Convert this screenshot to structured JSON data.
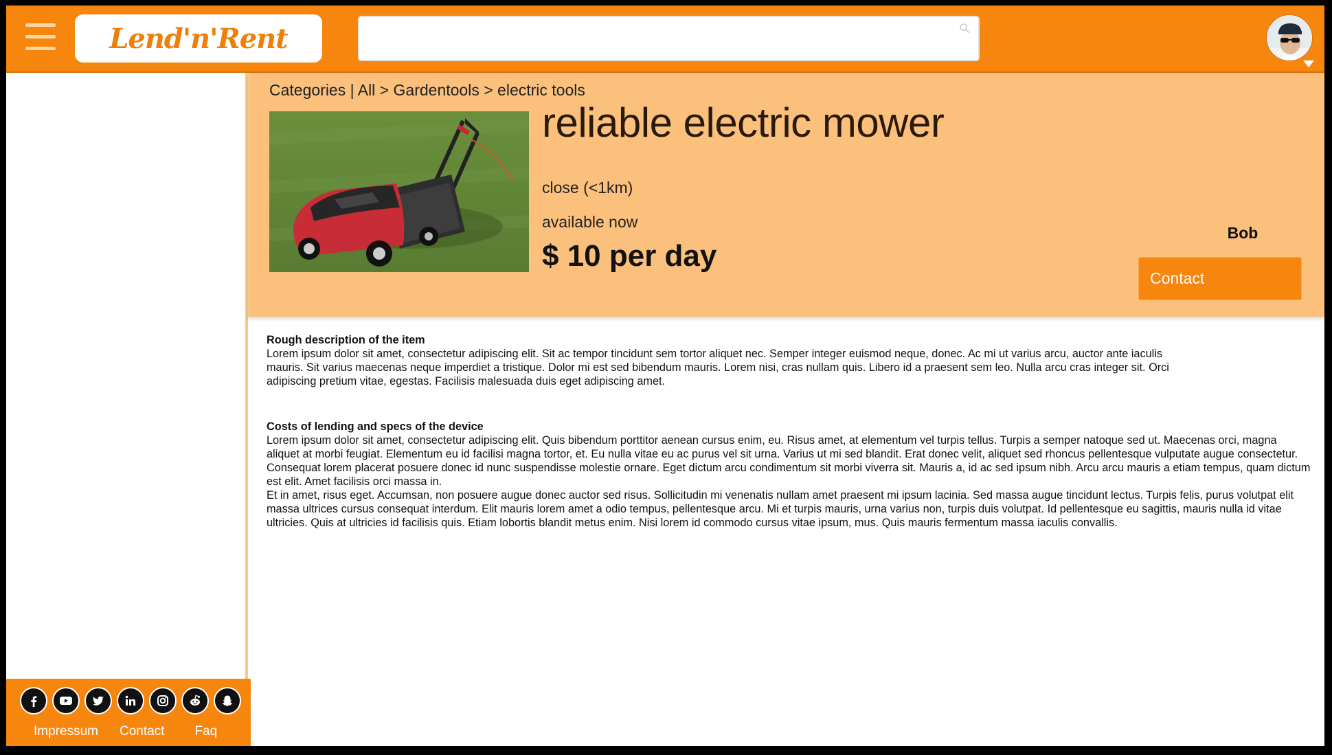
{
  "header": {
    "logo_text": "Lend'n'Rent",
    "search_placeholder": "",
    "menu_icon": "hamburger-menu-icon",
    "search_icon": "search-icon",
    "avatar_icon": "user-avatar",
    "caret_icon": "caret-down-icon"
  },
  "colors": {
    "brand": "#f7860f",
    "panel": "#fcc07d",
    "sidebar_border": "#f6c68a"
  },
  "item": {
    "breadcrumb": {
      "root": "Categories",
      "separator": " | ",
      "all": "All",
      "arrow1": " > ",
      "category": "Gardentools",
      "arrow2": " > ",
      "subcategory": "electric tools"
    },
    "title": "reliable electric mower",
    "distance": "close (<1km)",
    "availability": "available now",
    "price": "$ 10 per day",
    "owner": "Bob",
    "contact_label": "Contact"
  },
  "description": {
    "heading1": "Rough description of the item",
    "text1": "Lorem ipsum dolor sit amet, consectetur adipiscing elit. Sit ac tempor tincidunt sem tortor aliquet nec. Semper integer euismod neque, donec. Ac mi ut varius arcu, auctor ante iaculis mauris. Sit varius maecenas neque imperdiet a tristique. Dolor mi est sed bibendum mauris. Lorem nisi, cras nullam quis. Libero id a praesent sem leo. Nulla arcu cras integer sit. Orci adipiscing pretium vitae, egestas. Facilisis malesuada duis eget adipiscing amet.",
    "heading2": "Costs of lending and specs of the device",
    "text2": "Lorem ipsum dolor sit amet, consectetur adipiscing elit. Quis bibendum porttitor aenean cursus enim, eu. Risus amet, at elementum vel turpis tellus. Turpis a semper natoque sed ut. Maecenas orci, magna aliquet at morbi feugiat. Elementum eu id facilisi magna tortor, et. Eu nulla vitae eu ac purus vel sit urna. Varius ut mi sed blandit. Erat donec velit, aliquet sed rhoncus pellentesque vulputate augue consectetur. Consequat lorem placerat posuere donec id nunc suspendisse molestie ornare. Eget dictum arcu condimentum sit morbi viverra sit. Mauris a, id ac sed ipsum nibh. Arcu arcu mauris a etiam tempus, quam dictum est elit. Amet facilisis orci massa in.",
    "text3": "Et in amet, risus eget. Accumsan, non posuere augue donec auctor sed risus. Sollicitudin mi venenatis nullam amet praesent mi ipsum lacinia. Sed massa augue tincidunt lectus. Turpis felis, purus volutpat elit massa ultrices cursus consequat interdum. Elit mauris lorem amet a odio tempus, pellentesque arcu. Mi et turpis mauris, urna varius non, turpis duis volutpat. Id pellentesque eu sagittis, mauris nulla id vitae ultricies. Quis at ultricies id facilisis quis. Etiam lobortis blandit metus enim. Nisi lorem id commodo cursus vitae ipsum, mus. Quis mauris fermentum massa iaculis convallis."
  },
  "footer": {
    "socials": [
      "facebook-icon",
      "youtube-icon",
      "twitter-icon",
      "linkedin-icon",
      "instagram-icon",
      "reddit-icon",
      "snapchat-icon"
    ],
    "links": {
      "impressum": "Impressum",
      "contact": "Contact",
      "faq": "Faq"
    }
  }
}
